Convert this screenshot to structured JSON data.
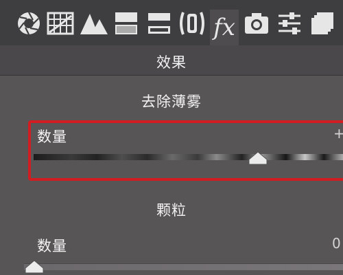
{
  "toolbar": {
    "tools": [
      {
        "name": "aperture-icon"
      },
      {
        "name": "grid-icon"
      },
      {
        "name": "mountain-icon"
      },
      {
        "name": "split-toning-icon"
      },
      {
        "name": "detail-icon"
      },
      {
        "name": "lens-icon"
      },
      {
        "name": "fx-icon",
        "label": "fx",
        "active": true
      },
      {
        "name": "camera-icon"
      },
      {
        "name": "sliders-icon"
      },
      {
        "name": "presets-icon"
      }
    ]
  },
  "effects": {
    "title": "效果",
    "dehaze": {
      "title": "去除薄雾",
      "label": "数量",
      "value": "+",
      "level_percent": 71
    },
    "grain": {
      "title": "颗粒",
      "label": "数量",
      "value": "0",
      "level_percent": 0
    }
  },
  "colors": {
    "background": "#585557",
    "toolbar": "#3e3d3f",
    "highlight": "#d11c22"
  }
}
